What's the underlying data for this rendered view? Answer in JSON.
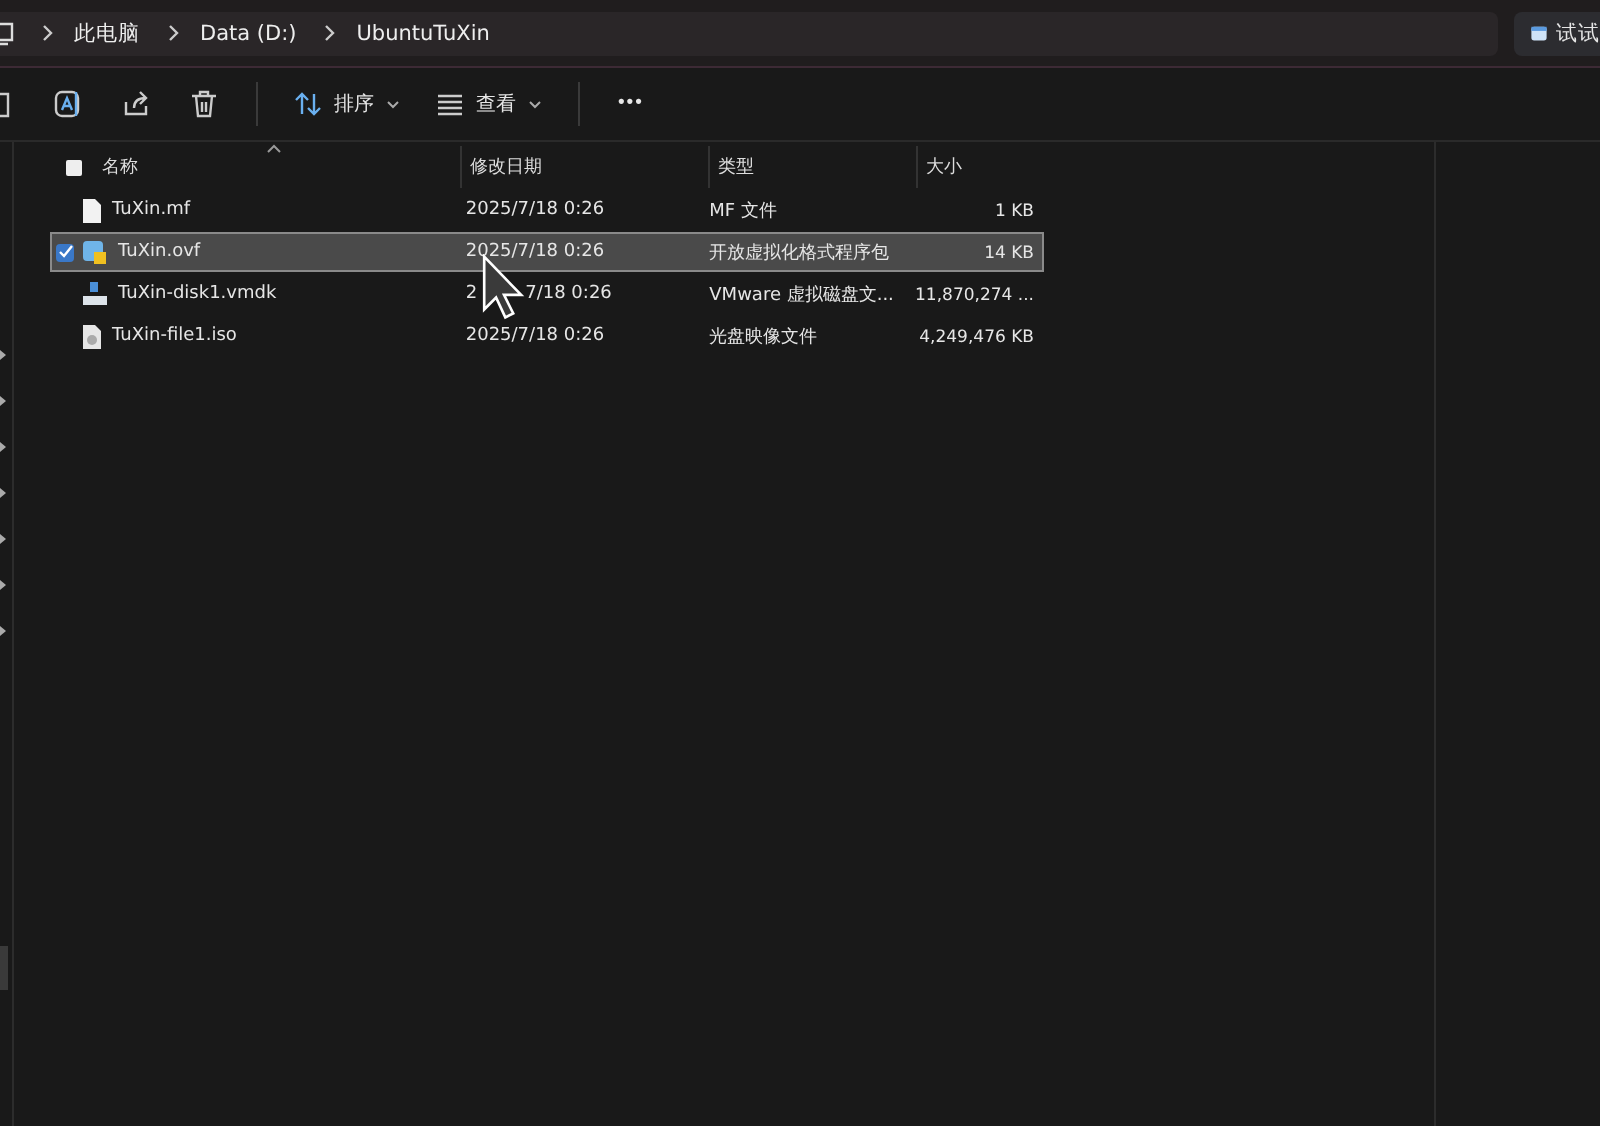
{
  "breadcrumb": [
    "此电脑",
    "Data (D:)",
    "UbuntuTuXin"
  ],
  "search_tab": {
    "label": "试试"
  },
  "toolbar": {
    "sort": "排序",
    "view": "查看",
    "more": "•••"
  },
  "columns": [
    "名称",
    "修改日期",
    "类型",
    "大小"
  ],
  "select_all": {
    "checked": false
  },
  "files": [
    {
      "name": "TuXin.mf",
      "kind": "doc",
      "date": "2025/7/18 0:26",
      "type": "MF 文件",
      "size": "1 KB",
      "selected": false
    },
    {
      "name": "TuXin.ovf",
      "kind": "package",
      "date": "2025/7/18 0:26",
      "type": "开放虚拟化格式程序包",
      "size": "14 KB",
      "selected": true
    },
    {
      "name": "TuXin-disk1.vmdk",
      "kind": "disk",
      "date_lead": "2",
      "date": "7/18 0:26",
      "type": "VMware 虚拟磁盘文...",
      "size": "11,870,274 ...",
      "selected": false
    },
    {
      "name": "TuXin-file1.iso",
      "kind": "disc",
      "date": "2025/7/18 0:26",
      "type": "光盘映像文件",
      "size": "4,249,476 KB",
      "selected": false
    }
  ]
}
